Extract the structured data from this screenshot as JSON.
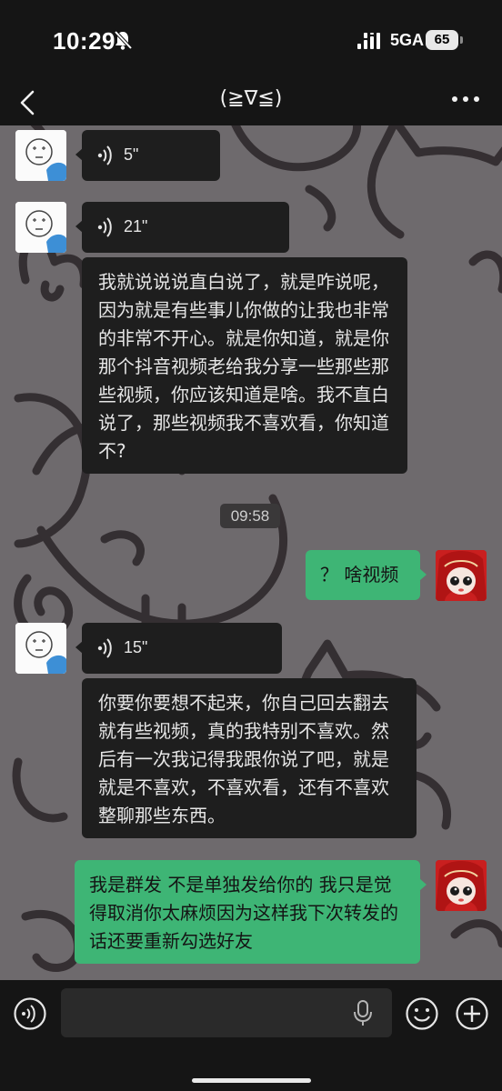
{
  "status_bar": {
    "time": "10:29",
    "network": "5GA",
    "battery": "65"
  },
  "nav": {
    "title": "(≧∇≦)"
  },
  "messages": {
    "voice_1": {
      "duration": "5\""
    },
    "voice_2": {
      "duration": "21\""
    },
    "text_1": "我就说说说直白说了，就是咋说呢，因为就是有些事儿你做的让我也非常的非常不开心。就是你知道，就是你那个抖音视频老给我分享一些那些那些视频，你应该知道是啥。我不直白说了，那些视频我不喜欢看，你知道不?",
    "timestamp": "09:58",
    "reply_1": "？ 啥视频",
    "voice_3": {
      "duration": "15\""
    },
    "text_2": "你要你要想不起来，你自己回去翻去就有些视频，真的我特别不喜欢。然后有一次我记得我跟你说了吧，就是就是不喜欢，不喜欢看，还有不喜欢整聊那些东西。",
    "reply_2": "我是群发 不是单独发给你的 我只是觉得取消你太麻烦因为这样我下次转发的话还要重新勾选好友"
  },
  "colors": {
    "chat_background": "#6e6a6d",
    "incoming_bubble": "#1e1e1e",
    "outgoing_bubble": "#3eb575",
    "bar_background": "#151515"
  },
  "icons": {
    "mute": "bell-slash-icon",
    "back": "chevron-left-icon",
    "more": "more-horizontal-icon",
    "voice_toggle": "voice-mode-icon",
    "mic": "microphone-icon",
    "emoji": "emoji-icon",
    "add": "plus-circle-icon"
  }
}
